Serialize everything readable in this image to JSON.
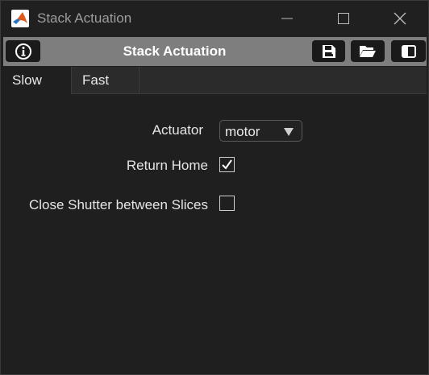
{
  "window": {
    "title": "Stack Actuation",
    "app_icon": "matlab-icon"
  },
  "toolbar": {
    "title": "Stack Actuation",
    "buttons": [
      {
        "name": "info",
        "icon": "info-icon"
      },
      {
        "name": "save",
        "icon": "save-icon"
      },
      {
        "name": "open",
        "icon": "folder-open-icon"
      },
      {
        "name": "toggle-panel",
        "icon": "panel-toggle-icon"
      }
    ]
  },
  "tabs": [
    {
      "label": "Slow",
      "selected": true
    },
    {
      "label": "Fast",
      "selected": false
    }
  ],
  "form": {
    "actuator": {
      "label": "Actuator",
      "value": "motor"
    },
    "return_home": {
      "label": "Return Home",
      "checked": true
    },
    "close_shutter": {
      "label": "Close Shutter between Slices",
      "checked": false
    }
  },
  "colors": {
    "background": "#1f1f1f",
    "toolbar": "#7e7e7e",
    "title_text": "#9d9d9d"
  }
}
